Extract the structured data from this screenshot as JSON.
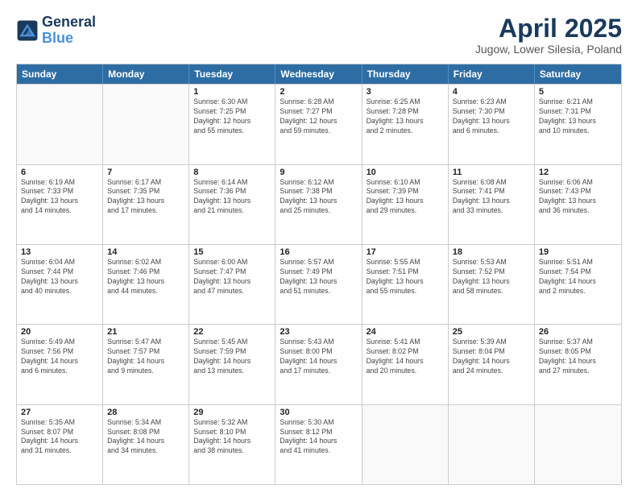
{
  "header": {
    "logo_line1": "General",
    "logo_line2": "Blue",
    "month_year": "April 2025",
    "location": "Jugow, Lower Silesia, Poland"
  },
  "calendar": {
    "weekdays": [
      "Sunday",
      "Monday",
      "Tuesday",
      "Wednesday",
      "Thursday",
      "Friday",
      "Saturday"
    ],
    "rows": [
      [
        {
          "day": "",
          "info": ""
        },
        {
          "day": "",
          "info": ""
        },
        {
          "day": "1",
          "info": "Sunrise: 6:30 AM\nSunset: 7:25 PM\nDaylight: 12 hours\nand 55 minutes."
        },
        {
          "day": "2",
          "info": "Sunrise: 6:28 AM\nSunset: 7:27 PM\nDaylight: 12 hours\nand 59 minutes."
        },
        {
          "day": "3",
          "info": "Sunrise: 6:25 AM\nSunset: 7:28 PM\nDaylight: 13 hours\nand 2 minutes."
        },
        {
          "day": "4",
          "info": "Sunrise: 6:23 AM\nSunset: 7:30 PM\nDaylight: 13 hours\nand 6 minutes."
        },
        {
          "day": "5",
          "info": "Sunrise: 6:21 AM\nSunset: 7:31 PM\nDaylight: 13 hours\nand 10 minutes."
        }
      ],
      [
        {
          "day": "6",
          "info": "Sunrise: 6:19 AM\nSunset: 7:33 PM\nDaylight: 13 hours\nand 14 minutes."
        },
        {
          "day": "7",
          "info": "Sunrise: 6:17 AM\nSunset: 7:35 PM\nDaylight: 13 hours\nand 17 minutes."
        },
        {
          "day": "8",
          "info": "Sunrise: 6:14 AM\nSunset: 7:36 PM\nDaylight: 13 hours\nand 21 minutes."
        },
        {
          "day": "9",
          "info": "Sunrise: 6:12 AM\nSunset: 7:38 PM\nDaylight: 13 hours\nand 25 minutes."
        },
        {
          "day": "10",
          "info": "Sunrise: 6:10 AM\nSunset: 7:39 PM\nDaylight: 13 hours\nand 29 minutes."
        },
        {
          "day": "11",
          "info": "Sunrise: 6:08 AM\nSunset: 7:41 PM\nDaylight: 13 hours\nand 33 minutes."
        },
        {
          "day": "12",
          "info": "Sunrise: 6:06 AM\nSunset: 7:43 PM\nDaylight: 13 hours\nand 36 minutes."
        }
      ],
      [
        {
          "day": "13",
          "info": "Sunrise: 6:04 AM\nSunset: 7:44 PM\nDaylight: 13 hours\nand 40 minutes."
        },
        {
          "day": "14",
          "info": "Sunrise: 6:02 AM\nSunset: 7:46 PM\nDaylight: 13 hours\nand 44 minutes."
        },
        {
          "day": "15",
          "info": "Sunrise: 6:00 AM\nSunset: 7:47 PM\nDaylight: 13 hours\nand 47 minutes."
        },
        {
          "day": "16",
          "info": "Sunrise: 5:57 AM\nSunset: 7:49 PM\nDaylight: 13 hours\nand 51 minutes."
        },
        {
          "day": "17",
          "info": "Sunrise: 5:55 AM\nSunset: 7:51 PM\nDaylight: 13 hours\nand 55 minutes."
        },
        {
          "day": "18",
          "info": "Sunrise: 5:53 AM\nSunset: 7:52 PM\nDaylight: 13 hours\nand 58 minutes."
        },
        {
          "day": "19",
          "info": "Sunrise: 5:51 AM\nSunset: 7:54 PM\nDaylight: 14 hours\nand 2 minutes."
        }
      ],
      [
        {
          "day": "20",
          "info": "Sunrise: 5:49 AM\nSunset: 7:56 PM\nDaylight: 14 hours\nand 6 minutes."
        },
        {
          "day": "21",
          "info": "Sunrise: 5:47 AM\nSunset: 7:57 PM\nDaylight: 14 hours\nand 9 minutes."
        },
        {
          "day": "22",
          "info": "Sunrise: 5:45 AM\nSunset: 7:59 PM\nDaylight: 14 hours\nand 13 minutes."
        },
        {
          "day": "23",
          "info": "Sunrise: 5:43 AM\nSunset: 8:00 PM\nDaylight: 14 hours\nand 17 minutes."
        },
        {
          "day": "24",
          "info": "Sunrise: 5:41 AM\nSunset: 8:02 PM\nDaylight: 14 hours\nand 20 minutes."
        },
        {
          "day": "25",
          "info": "Sunrise: 5:39 AM\nSunset: 8:04 PM\nDaylight: 14 hours\nand 24 minutes."
        },
        {
          "day": "26",
          "info": "Sunrise: 5:37 AM\nSunset: 8:05 PM\nDaylight: 14 hours\nand 27 minutes."
        }
      ],
      [
        {
          "day": "27",
          "info": "Sunrise: 5:35 AM\nSunset: 8:07 PM\nDaylight: 14 hours\nand 31 minutes."
        },
        {
          "day": "28",
          "info": "Sunrise: 5:34 AM\nSunset: 8:08 PM\nDaylight: 14 hours\nand 34 minutes."
        },
        {
          "day": "29",
          "info": "Sunrise: 5:32 AM\nSunset: 8:10 PM\nDaylight: 14 hours\nand 38 minutes."
        },
        {
          "day": "30",
          "info": "Sunrise: 5:30 AM\nSunset: 8:12 PM\nDaylight: 14 hours\nand 41 minutes."
        },
        {
          "day": "",
          "info": ""
        },
        {
          "day": "",
          "info": ""
        },
        {
          "day": "",
          "info": ""
        }
      ]
    ]
  }
}
